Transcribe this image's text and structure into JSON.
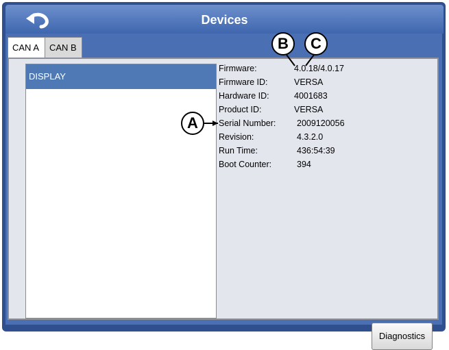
{
  "window": {
    "title": "Devices"
  },
  "tabs": [
    {
      "label": "CAN A"
    },
    {
      "label": "CAN B"
    }
  ],
  "device_list": [
    {
      "label": "DISPLAY"
    }
  ],
  "device_info": [
    {
      "label": "Firmware:",
      "value": "4.0.18/4.0.17"
    },
    {
      "label": "Firmware ID:",
      "value": "VERSA"
    },
    {
      "label": "Hardware ID:",
      "value": "4001683"
    },
    {
      "label": "Product ID:",
      "value": "VERSA"
    },
    {
      "label": "Serial Number:",
      "value": "2009120056"
    },
    {
      "label": "Revision:",
      "value": "4.3.2.0"
    },
    {
      "label": "Run Time:",
      "value": "436:54:39"
    },
    {
      "label": "Boot Counter:",
      "value": "394"
    }
  ],
  "buttons": {
    "diagnostics": "Diagnostics"
  },
  "callouts": [
    "A",
    "B",
    "C"
  ],
  "icons": {
    "back": "back-arrow-icon"
  }
}
